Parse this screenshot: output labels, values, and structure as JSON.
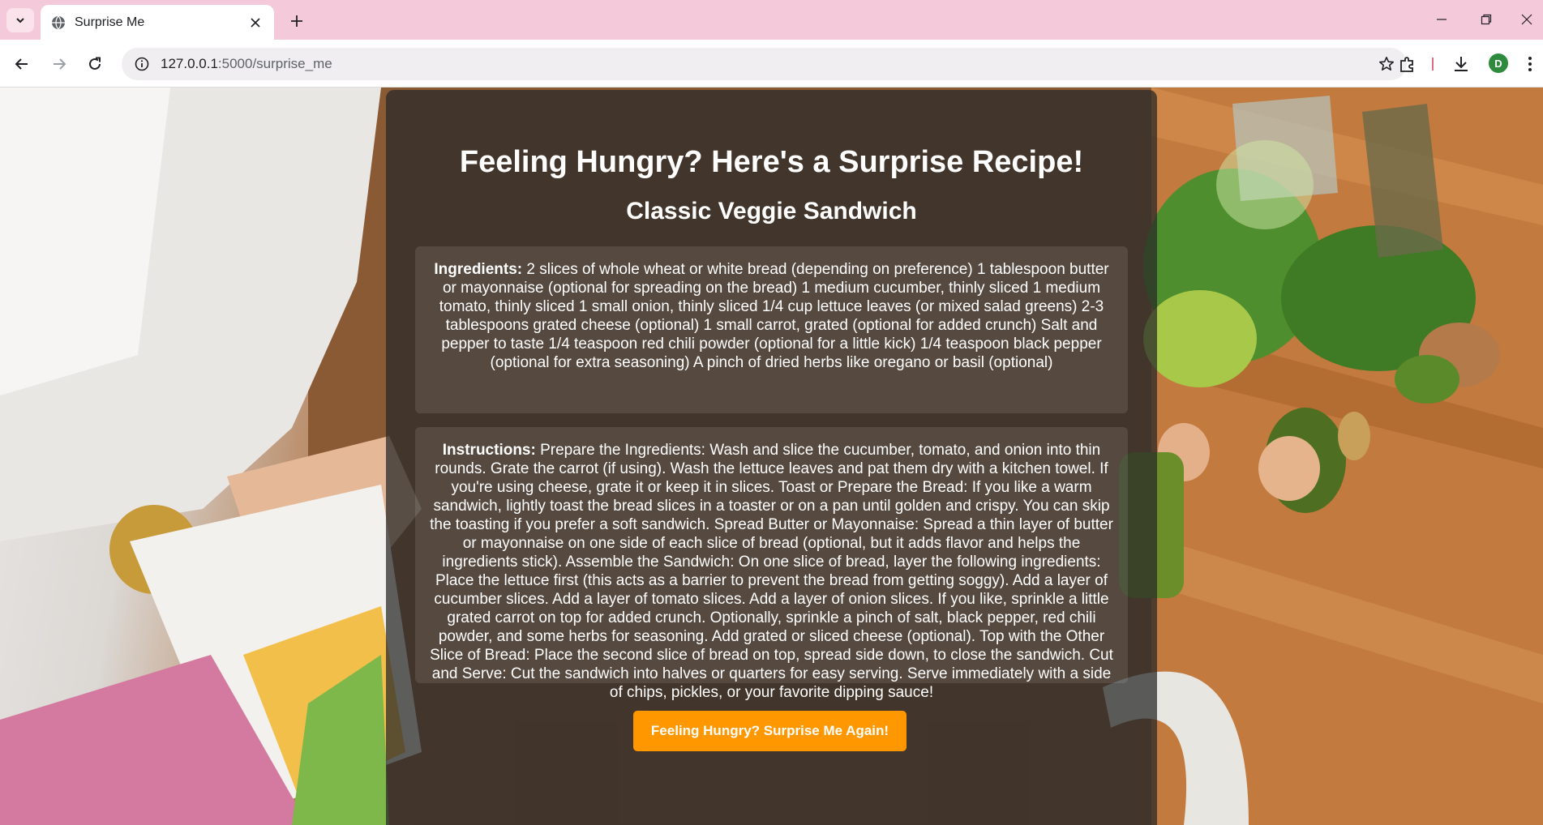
{
  "browser": {
    "tab_title": "Surprise Me",
    "url_host": "127.0.0.1",
    "url_path": ":5000/surprise_me",
    "profile_initial": "D",
    "icons": [
      "tab-list-icon",
      "globe-icon",
      "close-icon",
      "plus-icon",
      "minimize-icon",
      "restore-icon",
      "window-close-icon",
      "back-icon",
      "forward-icon",
      "reload-icon",
      "site-info-icon",
      "star-icon",
      "extensions-icon",
      "download-icon",
      "more-menu-icon"
    ]
  },
  "page": {
    "title": "Feeling Hungry? Here's a Surprise Recipe!",
    "recipe_name": "Classic Veggie Sandwich",
    "ingredients_label": "Ingredients:",
    "ingredients_text": " 2 slices of whole wheat or white bread (depending on preference) 1 tablespoon butter or mayonnaise (optional for spreading on the bread) 1 medium cucumber, thinly sliced 1 medium tomato, thinly sliced 1 small onion, thinly sliced 1/4 cup lettuce leaves (or mixed salad greens) 2-3 tablespoons grated cheese (optional) 1 small carrot, grated (optional for added crunch) Salt and pepper to taste 1/4 teaspoon red chili powder (optional for a little kick) 1/4 teaspoon black pepper (optional for extra seasoning) A pinch of dried herbs like oregano or basil (optional)",
    "instructions_label": "Instructions:",
    "instructions_text": " Prepare the Ingredients: Wash and slice the cucumber, tomato, and onion into thin rounds. Grate the carrot (if using). Wash the lettuce leaves and pat them dry with a kitchen towel. If you're using cheese, grate it or keep it in slices. Toast or Prepare the Bread: If you like a warm sandwich, lightly toast the bread slices in a toaster or on a pan until golden and crispy. You can skip the toasting if you prefer a soft sandwich. Spread Butter or Mayonnaise: Spread a thin layer of butter or mayonnaise on one side of each slice of bread (optional, but it adds flavor and helps the ingredients stick). Assemble the Sandwich: On one slice of bread, layer the following ingredients: Place the lettuce first (this acts as a barrier to prevent the bread from getting soggy). Add a layer of cucumber slices. Add a layer of tomato slices. Add a layer of onion slices. If you like, sprinkle a little grated carrot on top for added crunch. Optionally, sprinkle a pinch of salt, black pepper, red chili powder, and some herbs for seasoning. Add grated or sliced cheese (optional). Top with the Other Slice of Bread: Place the second slice of bread on top, spread side down, to close the sandwich. Cut and Serve: Cut the sandwich into halves or quarters for easy serving. Serve immediately with a side of chips, pickles, or your favorite dipping sauce!",
    "button_label": "Feeling Hungry? Surprise Me Again!"
  },
  "colors": {
    "tabbar": "#f4c9d9",
    "button": "#ff9800",
    "card": "rgba(40,40,40,0.74)",
    "avatar": "#2e8b3e"
  }
}
